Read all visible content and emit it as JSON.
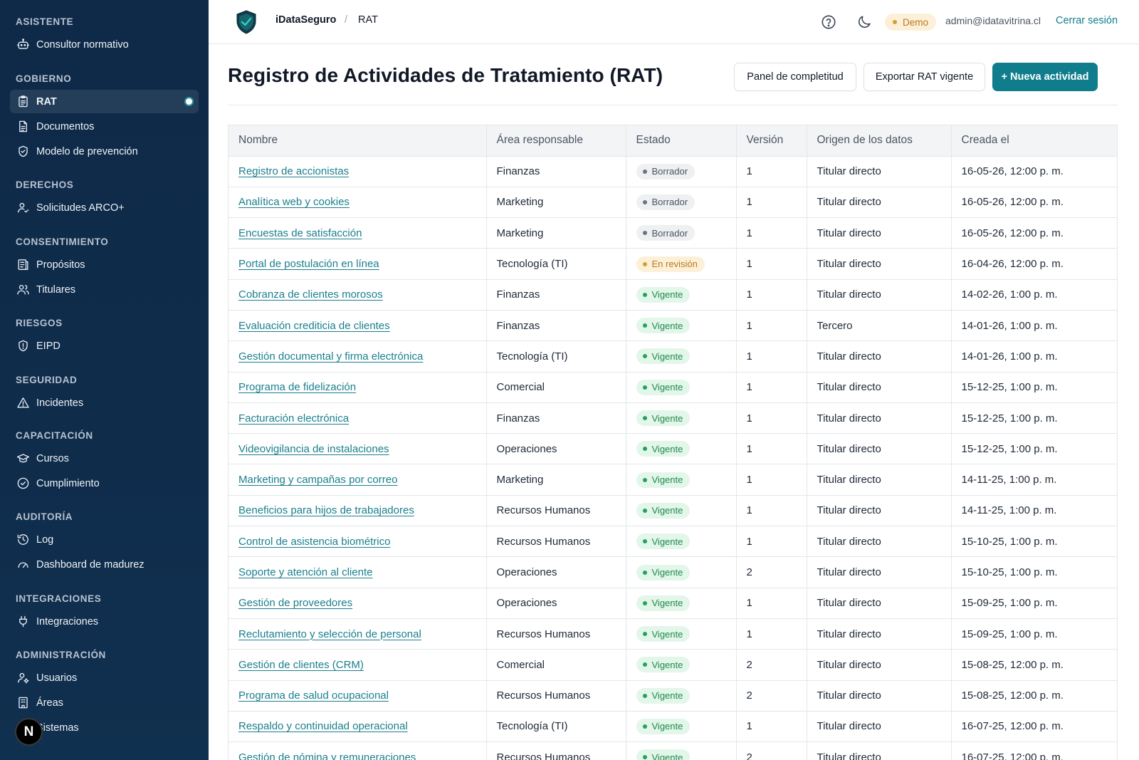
{
  "sidebar": {
    "sections": [
      {
        "heading": "ASISTENTE",
        "items": [
          {
            "label": "Consultor normativo",
            "icon": "bot-icon"
          }
        ]
      },
      {
        "heading": "GOBIERNO",
        "items": [
          {
            "label": "RAT",
            "icon": "clipboard-icon",
            "active": true
          },
          {
            "label": "Documentos",
            "icon": "document-icon"
          },
          {
            "label": "Modelo de prevención",
            "icon": "shield-check-icon"
          }
        ]
      },
      {
        "heading": "DERECHOS",
        "items": [
          {
            "label": "Solicitudes ARCO+",
            "icon": "user-check-icon"
          }
        ]
      },
      {
        "heading": "CONSENTIMIENTO",
        "items": [
          {
            "label": "Propósitos",
            "icon": "list-icon"
          },
          {
            "label": "Titulares",
            "icon": "users-icon"
          }
        ]
      },
      {
        "heading": "RIESGOS",
        "items": [
          {
            "label": "EIPD",
            "icon": "shield-alert-icon"
          }
        ]
      },
      {
        "heading": "SEGURIDAD",
        "items": [
          {
            "label": "Incidentes",
            "icon": "warning-icon"
          }
        ]
      },
      {
        "heading": "CAPACITACIÓN",
        "items": [
          {
            "label": "Cursos",
            "icon": "graduation-cap-icon"
          },
          {
            "label": "Cumplimiento",
            "icon": "check-circle-icon"
          }
        ]
      },
      {
        "heading": "AUDITORÍA",
        "items": [
          {
            "label": "Log",
            "icon": "history-icon"
          },
          {
            "label": "Dashboard de madurez",
            "icon": "gauge-icon"
          }
        ]
      },
      {
        "heading": "INTEGRACIONES",
        "items": [
          {
            "label": "Integraciones",
            "icon": "plug-icon"
          }
        ]
      },
      {
        "heading": "ADMINISTRACIÓN",
        "items": [
          {
            "label": "Usuarios",
            "icon": "user-cog-icon"
          },
          {
            "label": "Áreas",
            "icon": "building-icon"
          },
          {
            "label": "Sistemas",
            "icon": "server-icon"
          }
        ]
      }
    ],
    "floating_badge": "N"
  },
  "topbar": {
    "brand": "iDataSeguro",
    "separator": "/",
    "breadcrumb": "RAT",
    "demo_label": "Demo",
    "user_email": "admin@idatavitrina.cl",
    "logout_label": "Cerrar sesión"
  },
  "page": {
    "title": "Registro de Actividades de Tratamiento (RAT)",
    "buttons": {
      "panel": "Panel de completitud",
      "export": "Exportar RAT vigente",
      "new": "+ Nueva actividad"
    }
  },
  "table": {
    "columns": [
      "Nombre",
      "Área responsable",
      "Estado",
      "Versión",
      "Origen de los datos",
      "Creada el"
    ],
    "rows": [
      {
        "name": "Registro de accionistas",
        "area": "Finanzas",
        "status": "Borrador",
        "status_kind": "borrador",
        "version": "1",
        "origin": "Titular directo",
        "created": "16-05-26, 12:00 p. m."
      },
      {
        "name": "Analítica web y cookies",
        "area": "Marketing",
        "status": "Borrador",
        "status_kind": "borrador",
        "version": "1",
        "origin": "Titular directo",
        "created": "16-05-26, 12:00 p. m."
      },
      {
        "name": "Encuestas de satisfacción",
        "area": "Marketing",
        "status": "Borrador",
        "status_kind": "borrador",
        "version": "1",
        "origin": "Titular directo",
        "created": "16-05-26, 12:00 p. m."
      },
      {
        "name": "Portal de postulación en línea",
        "area": "Tecnología (TI)",
        "status": "En revisión",
        "status_kind": "revision",
        "version": "1",
        "origin": "Titular directo",
        "created": "16-04-26, 12:00 p. m."
      },
      {
        "name": "Cobranza de clientes morosos",
        "area": "Finanzas",
        "status": "Vigente",
        "status_kind": "vigente",
        "version": "1",
        "origin": "Titular directo",
        "created": "14-02-26, 1:00 p. m."
      },
      {
        "name": "Evaluación crediticia de clientes",
        "area": "Finanzas",
        "status": "Vigente",
        "status_kind": "vigente",
        "version": "1",
        "origin": "Tercero",
        "created": "14-01-26, 1:00 p. m."
      },
      {
        "name": "Gestión documental y firma electrónica",
        "area": "Tecnología (TI)",
        "status": "Vigente",
        "status_kind": "vigente",
        "version": "1",
        "origin": "Titular directo",
        "created": "14-01-26, 1:00 p. m."
      },
      {
        "name": "Programa de fidelización",
        "area": "Comercial",
        "status": "Vigente",
        "status_kind": "vigente",
        "version": "1",
        "origin": "Titular directo",
        "created": "15-12-25, 1:00 p. m."
      },
      {
        "name": "Facturación electrónica",
        "area": "Finanzas",
        "status": "Vigente",
        "status_kind": "vigente",
        "version": "1",
        "origin": "Titular directo",
        "created": "15-12-25, 1:00 p. m."
      },
      {
        "name": "Videovigilancia de instalaciones",
        "area": "Operaciones",
        "status": "Vigente",
        "status_kind": "vigente",
        "version": "1",
        "origin": "Titular directo",
        "created": "15-12-25, 1:00 p. m."
      },
      {
        "name": "Marketing y campañas por correo",
        "area": "Marketing",
        "status": "Vigente",
        "status_kind": "vigente",
        "version": "1",
        "origin": "Titular directo",
        "created": "14-11-25, 1:00 p. m."
      },
      {
        "name": "Beneficios para hijos de trabajadores",
        "area": "Recursos Humanos",
        "status": "Vigente",
        "status_kind": "vigente",
        "version": "1",
        "origin": "Titular directo",
        "created": "14-11-25, 1:00 p. m."
      },
      {
        "name": "Control de asistencia biométrico",
        "area": "Recursos Humanos",
        "status": "Vigente",
        "status_kind": "vigente",
        "version": "1",
        "origin": "Titular directo",
        "created": "15-10-25, 1:00 p. m."
      },
      {
        "name": "Soporte y atención al cliente",
        "area": "Operaciones",
        "status": "Vigente",
        "status_kind": "vigente",
        "version": "2",
        "origin": "Titular directo",
        "created": "15-10-25, 1:00 p. m."
      },
      {
        "name": "Gestión de proveedores",
        "area": "Operaciones",
        "status": "Vigente",
        "status_kind": "vigente",
        "version": "1",
        "origin": "Titular directo",
        "created": "15-09-25, 1:00 p. m."
      },
      {
        "name": "Reclutamiento y selección de personal",
        "area": "Recursos Humanos",
        "status": "Vigente",
        "status_kind": "vigente",
        "version": "1",
        "origin": "Titular directo",
        "created": "15-09-25, 1:00 p. m."
      },
      {
        "name": "Gestión de clientes (CRM)",
        "area": "Comercial",
        "status": "Vigente",
        "status_kind": "vigente",
        "version": "2",
        "origin": "Titular directo",
        "created": "15-08-25, 12:00 p. m."
      },
      {
        "name": "Programa de salud ocupacional",
        "area": "Recursos Humanos",
        "status": "Vigente",
        "status_kind": "vigente",
        "version": "2",
        "origin": "Titular directo",
        "created": "15-08-25, 12:00 p. m."
      },
      {
        "name": "Respaldo y continuidad operacional",
        "area": "Tecnología (TI)",
        "status": "Vigente",
        "status_kind": "vigente",
        "version": "1",
        "origin": "Titular directo",
        "created": "16-07-25, 12:00 p. m."
      },
      {
        "name": "Gestión de nómina y remuneraciones",
        "area": "Recursos Humanos",
        "status": "Vigente",
        "status_kind": "vigente",
        "version": "2",
        "origin": "Titular directo",
        "created": "16-07-25, 12:00 p. m."
      }
    ]
  },
  "colors": {
    "sidebar_bg": "#0f2a48",
    "accent": "#0f7d8c",
    "link": "#1a7f8e"
  }
}
